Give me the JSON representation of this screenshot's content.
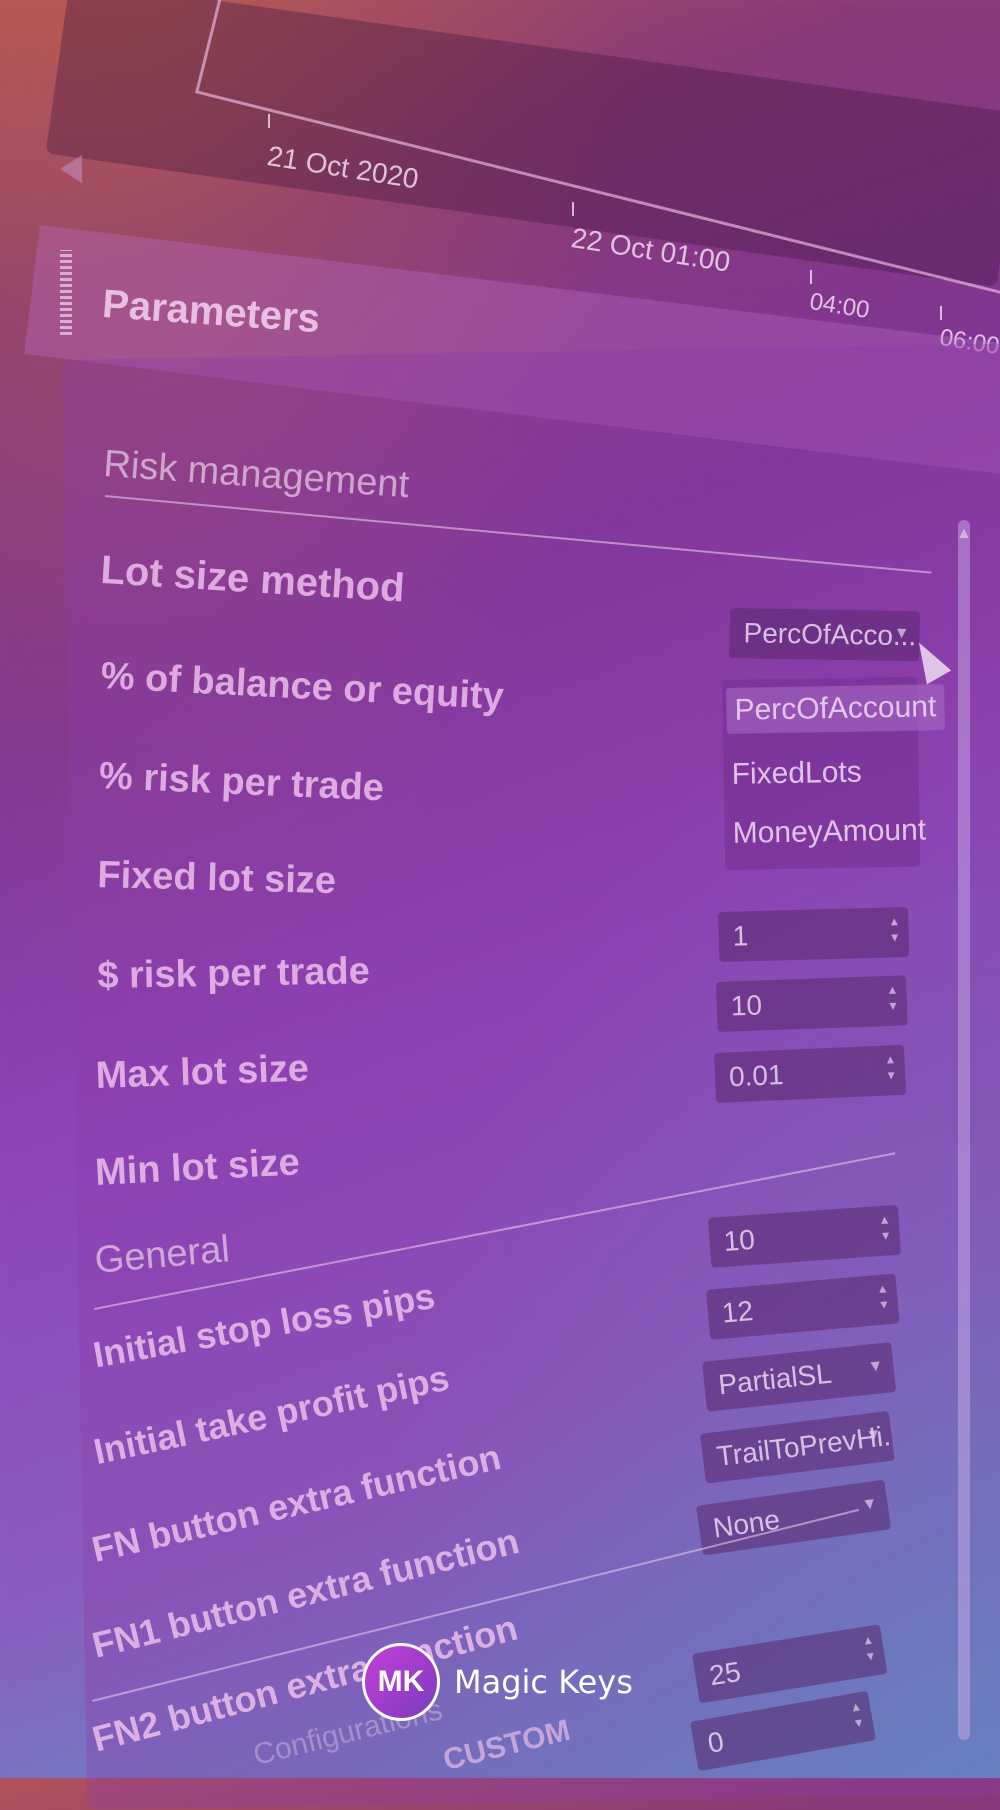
{
  "chart": {
    "x_ticks": [
      "21 Oct 2020",
      "22 Oct 01:00",
      "04:00",
      "06:00"
    ]
  },
  "panel": {
    "title": "Parameters"
  },
  "sections": {
    "risk": "Risk management",
    "general": "General",
    "configurations": "Configurations"
  },
  "labels": {
    "lot_size_method": "Lot size method",
    "pct_balance": "% of balance or equity",
    "pct_risk": "% risk per trade",
    "fixed_lot": "Fixed lot size",
    "dollar_risk": "$ risk per trade",
    "max_lot": "Max lot size",
    "min_lot": "Min lot size",
    "initial_sl": "Initial stop loss pips",
    "initial_tp": "Initial take profit pips",
    "fn": "FN button extra function",
    "fn1": "FN1 button extra function",
    "fn2": "FN2 button extra function",
    "custom": "CUSTOM"
  },
  "fields": {
    "lot_size_method": "PercOfAcco...",
    "dollar_risk": "1",
    "max_lot": "10",
    "min_lot": "0.01",
    "initial_sl": "10",
    "initial_tp": "12",
    "fn": "PartialSL",
    "fn1": "TrailToPrevHi...",
    "fn2": "None",
    "config_1": "25",
    "config_2": "0"
  },
  "dropdown": {
    "options": [
      "PercOfAccount",
      "FixedLots",
      "MoneyAmount"
    ],
    "selected": "PercOfAccount"
  },
  "branding": {
    "badge": "MK",
    "name": "Magic Keys"
  }
}
